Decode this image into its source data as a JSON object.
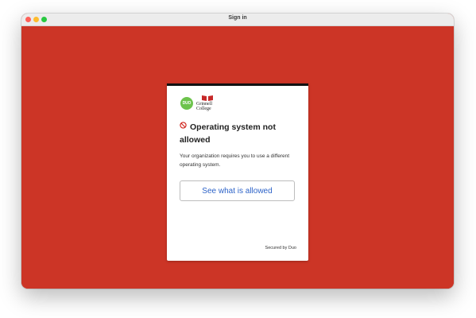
{
  "window": {
    "title": "Sign in",
    "background_color": "#cc3526"
  },
  "card": {
    "duo_logo_text": "DUO",
    "org_name": "Grinnell\nCollege",
    "heading_line1": "Operating system not",
    "heading_line2": "allowed",
    "description": "Your organization requires you to use a different operating system.",
    "button_label": "See what is allowed",
    "footer": "Secured by Duo"
  },
  "colors": {
    "accent_blue": "#2d63c8",
    "duo_green": "#6dc34c",
    "warning_red": "#d0271f"
  },
  "icons": {
    "status": "blocked-icon",
    "window_controls": [
      "close-icon",
      "minimize-icon",
      "maximize-icon"
    ]
  }
}
